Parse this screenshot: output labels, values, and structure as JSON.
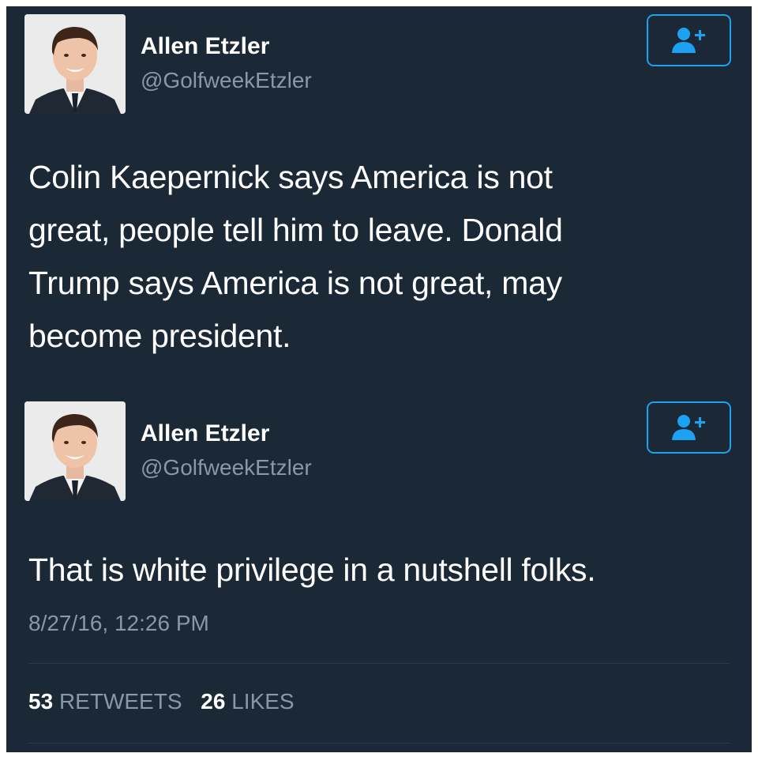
{
  "tweets": [
    {
      "user": {
        "name": "Allen Etzler",
        "handle": "@GolfweekEtzler"
      },
      "text": "Colin Kaepernick says America is not\ngreat, people tell him to leave. Donald\nTrump says America is not great, may\nbecome president."
    },
    {
      "user": {
        "name": "Allen Etzler",
        "handle": "@GolfweekEtzler"
      },
      "text": "That is white privilege in a nutshell folks."
    }
  ],
  "timestamp": "8/27/16, 12:26 PM",
  "stats": {
    "retweets_count": "53",
    "retweets_label": "RETWEETS",
    "likes_count": "26",
    "likes_label": "LIKES"
  },
  "icons": {
    "follow": "add-user-icon"
  },
  "colors": {
    "background": "#1b2836",
    "accent": "#1da1f2",
    "secondary_text": "#8899a6",
    "primary_text": "#ffffff"
  }
}
